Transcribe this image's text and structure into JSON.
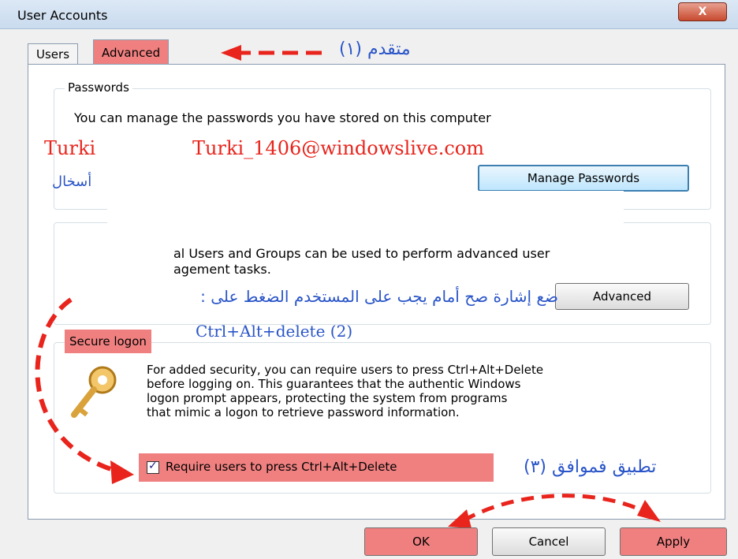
{
  "window": {
    "title": "User Accounts",
    "close_glyph": "X"
  },
  "tabs": [
    "Users",
    "Advanced"
  ],
  "passwords": {
    "title": "Passwords",
    "description": "You can manage the passwords you have stored on this computer",
    "manage_button": "Manage Passwords"
  },
  "users_groups": {
    "line1": "al Users and Groups can be used to perform advanced user",
    "line2": "agement tasks.",
    "advanced_button": "Advanced"
  },
  "secure_logon": {
    "title": "Secure logon",
    "desc_lines": [
      "For added security, you can require users to press Ctrl+Alt+Delete",
      "before logging on. This guarantees that the authentic Windows",
      "logon prompt appears, protecting the system from programs",
      "that mimic a logon to retrieve password information."
    ],
    "checkbox_label": "Require users to press Ctrl+Alt+Delete",
    "checkbox_checked": true
  },
  "buttons": {
    "ok": "OK",
    "cancel": "Cancel",
    "apply": "Apply"
  },
  "annotations": {
    "step1": "متقدم (١)",
    "turki": "Turki",
    "email": "Turki_1406@windowslive.com",
    "arabic_partial": "أسخال",
    "step2_text": "ضع إشارة صح أمام يجب على المستخدم الضغط على :",
    "step2_keys": "Ctrl+Alt+delete (2)",
    "step3": "تطبيق فموافق (٣)"
  },
  "colors": {
    "highlight": "#f08080",
    "annotation_red": "#e8241c",
    "annotation_blue": "#2a55c8"
  },
  "icons": {
    "key": "key-icon",
    "close": "close-icon",
    "check": "check-icon"
  }
}
